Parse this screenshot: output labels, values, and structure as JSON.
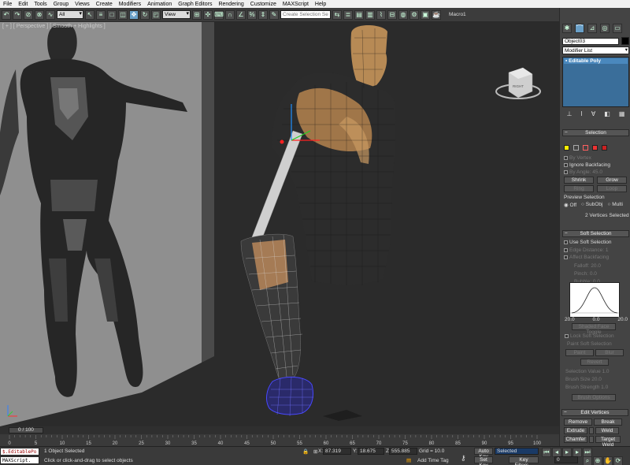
{
  "menu": [
    "File",
    "Edit",
    "Tools",
    "Group",
    "Views",
    "Create",
    "Modifiers",
    "Animation",
    "Graph Editors",
    "Rendering",
    "Customize",
    "MAXScript",
    "Help"
  ],
  "toolbar": {
    "selection_filter": "All",
    "reference_coord": "View",
    "named_selection_placeholder": "Create Selection Se",
    "macro_label": "Macro1"
  },
  "viewport": {
    "label": "[ + ] [ Perspective ] [ Smooth + Highlights ]",
    "viewcube_face": "RIGHT"
  },
  "command_panel": {
    "object_name": "Object03",
    "modifier_list": "Modifier List",
    "stack_item": "Editable Poly",
    "selection": {
      "title": "Selection",
      "by_vertex": "By Vertex",
      "ignore_backfacing": "Ignore Backfacing",
      "by_angle": "By Angle:",
      "by_angle_value": "45.0",
      "shrink": "Shrink",
      "grow": "Grow",
      "ring": "Ring",
      "loop": "Loop",
      "preview_selection": "Preview Selection",
      "preview_off": "Off",
      "preview_subobj": "SubObj",
      "preview_multi": "Multi",
      "status": "2 Vertices Selected"
    },
    "soft_selection": {
      "title": "Soft Selection",
      "use_soft": "Use Soft Selection",
      "edge_distance": "Edge Distance:",
      "edge_distance_value": "1",
      "affect_backfacing": "Affect Backfacing",
      "falloff": "Falloff:",
      "falloff_value": "20.0",
      "pinch": "Pinch:",
      "pinch_value": "0.0",
      "bubble": "Bubble:",
      "bubble_value": "0.0",
      "curve_left": "20.0",
      "curve_mid": "0.0",
      "curve_right": "20.0",
      "shaded_face_toggle": "Shaded Face Toggle",
      "lock_soft": "Lock Soft Selection",
      "paint_soft": "Paint Soft Selection",
      "paint": "Paint",
      "blur": "Blur",
      "revert": "Revert",
      "selection_value": "Selection Value",
      "selection_value_v": "1.0",
      "brush_size": "Brush Size",
      "brush_size_v": "20.0",
      "brush_strength": "Brush Strength",
      "brush_strength_v": "1.0",
      "brush_options": "Brush Options"
    },
    "edit_vertices": {
      "title": "Edit Vertices",
      "remove": "Remove",
      "break": "Break",
      "extrude": "Extrude",
      "weld": "Weld",
      "chamfer": "Chamfer",
      "target_weld": "Target Weld"
    }
  },
  "timeline": {
    "frame": "0 / 100",
    "ticks": [
      "0",
      "5",
      "10",
      "15",
      "20",
      "25",
      "30",
      "35",
      "40",
      "45",
      "50",
      "55",
      "60",
      "65",
      "70",
      "75",
      "80",
      "85",
      "90",
      "95",
      "100"
    ]
  },
  "status": {
    "maxscript_line1": "$.EditablePo",
    "maxscript_line2": "MAXScript.",
    "selected": "1 Object Selected",
    "prompt": "Click or click-and-drag to select objects",
    "x_label": "X:",
    "x": "87.319",
    "y_label": "Y:",
    "y": "18.675",
    "z_label": "Z:",
    "z": "555.885",
    "grid": "Grid = 10.0",
    "add_time_tag": "Add Time Tag",
    "auto_key": "Auto Key",
    "set_key": "Set Key",
    "key_mode": "Selected",
    "key_filters": "Key Filters...",
    "current_frame": "0"
  },
  "colors": {
    "vertex_icon": "#ffee00",
    "selected_wire": "#3a3aff",
    "mesh_base": "#2a2a2a",
    "mesh_highlight": "#c08a50",
    "reference_plane": "#8f8f8f"
  }
}
